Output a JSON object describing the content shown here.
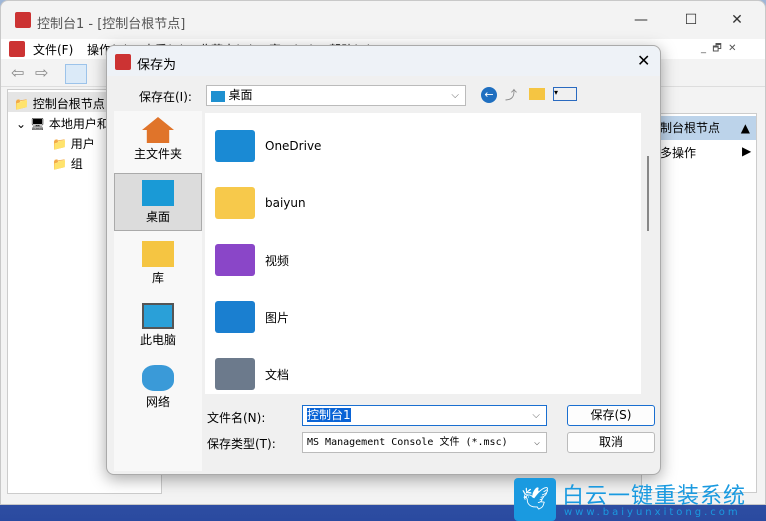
{
  "main_window": {
    "title": "控制台1 - [控制台根节点]",
    "menu": [
      "文件(F)",
      "操作(A)",
      "查看(V)",
      "收藏夹(O)",
      "窗口(W)",
      "帮助(H)"
    ],
    "tree": [
      "控制台根节点",
      "本地用户和组",
      "用户",
      "组"
    ],
    "actions": {
      "header": "控制台根节点",
      "more": "更多操作"
    }
  },
  "dialog": {
    "title": "保存为",
    "save_in_label": "保存在(I):",
    "save_in_value": "桌面",
    "places": [
      "主文件夹",
      "桌面",
      "库",
      "此电脑",
      "网络"
    ],
    "files": [
      "OneDrive",
      "baiyun",
      "视频",
      "图片",
      "文档"
    ],
    "filename_label": "文件名(N):",
    "filename_value": "控制台1",
    "type_label": "保存类型(T):",
    "type_value": "MS Management Console 文件 (*.msc)",
    "save_button": "保存(S)",
    "cancel_button": "取消"
  },
  "watermark": {
    "brand": "白云一键重装系统",
    "url": "www.baiyunxitong.com"
  }
}
